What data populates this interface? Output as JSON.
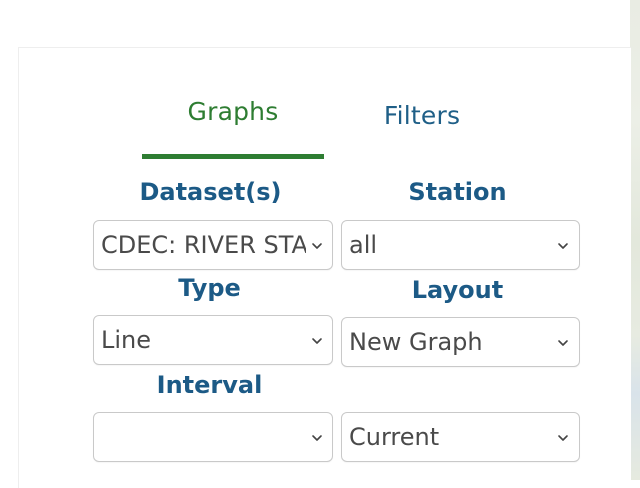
{
  "tabs": {
    "graphs": "Graphs",
    "filters": "Filters"
  },
  "form": {
    "dataset": {
      "label": "Dataset(s)",
      "value": "CDEC: RIVER STAGE"
    },
    "station": {
      "label": "Station",
      "value": "all"
    },
    "type": {
      "label": "Type",
      "value": "Line"
    },
    "layout": {
      "label": "Layout",
      "value": "New Graph"
    },
    "interval": {
      "label": "Interval",
      "value": ""
    },
    "period": {
      "value": "Current"
    }
  },
  "colors": {
    "active_tab": "#2e7d32",
    "inactive_tab": "#1f5f87",
    "label": "#1c5a86",
    "select_border": "#c9c9c9"
  },
  "icons": {
    "select_arrow": "chevron-down-icon"
  }
}
